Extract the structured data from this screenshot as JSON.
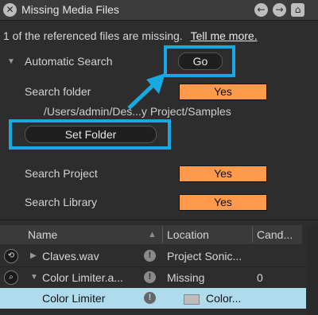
{
  "window": {
    "title": "Missing Media Files",
    "close_icon": "close-icon",
    "nav_back_icon": "arrow-left-icon",
    "nav_forward_icon": "arrow-right-icon",
    "home_icon": "home-icon"
  },
  "message": {
    "text": "1 of the referenced files are missing.",
    "link": "Tell me more."
  },
  "automatic_search": {
    "label": "Automatic Search",
    "go_label": "Go"
  },
  "search_folder": {
    "label": "Search folder",
    "value": "Yes",
    "path": "/Users/admin/Des...y Project/Samples",
    "set_folder_label": "Set Folder"
  },
  "search_project": {
    "label": "Search Project",
    "value": "Yes"
  },
  "search_library": {
    "label": "Search Library",
    "value": "Yes"
  },
  "table": {
    "columns": [
      "Name",
      "Location",
      "Cand..."
    ],
    "rows": [
      {
        "name": "Claves.wav",
        "location": "Project Sonic...",
        "candidates": ""
      },
      {
        "name": "Color Limiter.a...",
        "location": "Missing",
        "candidates": "0"
      },
      {
        "name": "Color Limiter",
        "location": "Color...",
        "candidates": ""
      }
    ]
  },
  "colors": {
    "accent_callout": "#17a9e2",
    "toggle_on": "#ff9a4d",
    "selection": "#aedced"
  }
}
